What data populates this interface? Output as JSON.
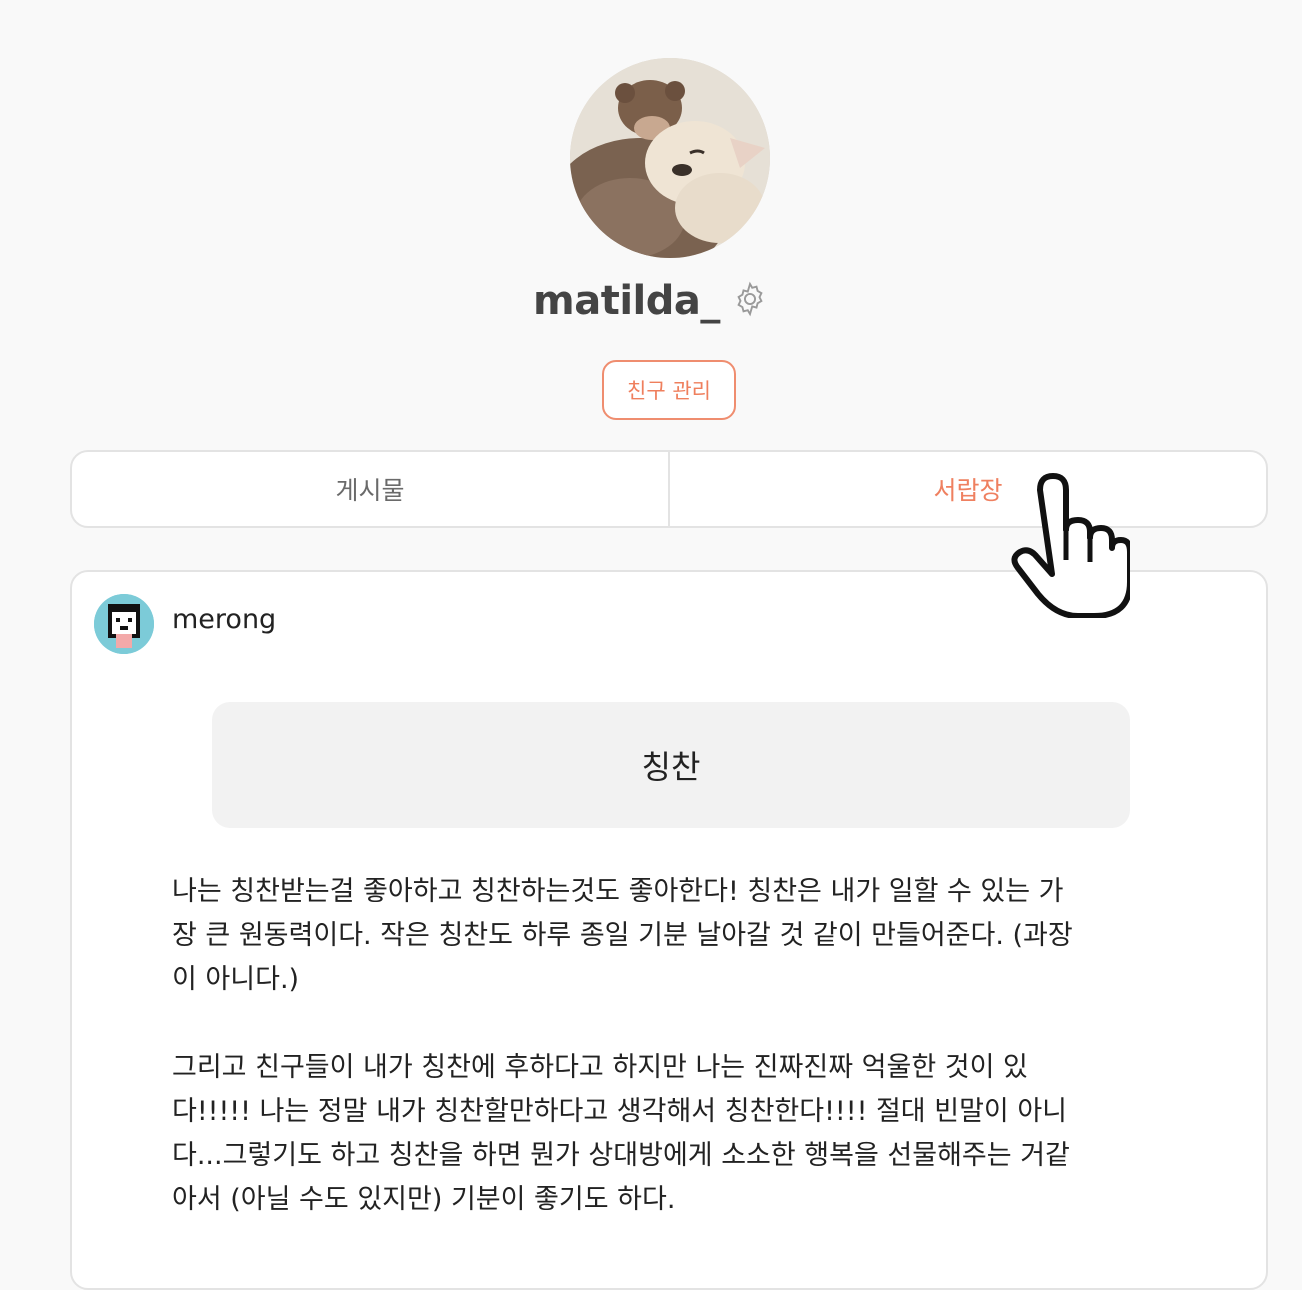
{
  "profile": {
    "username": "matilda_",
    "friend_manage_label": "친구 관리"
  },
  "tabs": [
    {
      "label": "게시물",
      "active": false
    },
    {
      "label": "서랍장",
      "active": true
    }
  ],
  "post": {
    "author": "merong",
    "topic": "칭찬",
    "paragraphs": [
      "나는 칭찬받는걸 좋아하고 칭찬하는것도 좋아한다! 칭찬은 내가 일할 수 있는 가\n장 큰 원동력이다. 작은 칭찬도 하루 종일 기분 날아갈 것 같이 만들어준다. (과장\n이 아니다.)",
      "그리고 친구들이 내가 칭찬에 후하다고 하지만 나는 진짜진짜 억울한 것이 있\n다!!!!! 나는 정말 내가 칭찬할만하다고 생각해서 칭찬한다!!!! 절대 빈말이 아니\n다...그렇기도 하고 칭찬을 하면 뭔가 상대방에게 소소한 행복을 선물해주는 거같\n아서 (아닐 수도 있지만) 기분이 좋기도 하다."
    ]
  },
  "colors": {
    "accent": "#ef8060",
    "border": "#e3e3e3",
    "background": "#f9f9f9"
  },
  "icons": {
    "settings": "gear-icon",
    "cursor": "hand-pointer-icon"
  }
}
